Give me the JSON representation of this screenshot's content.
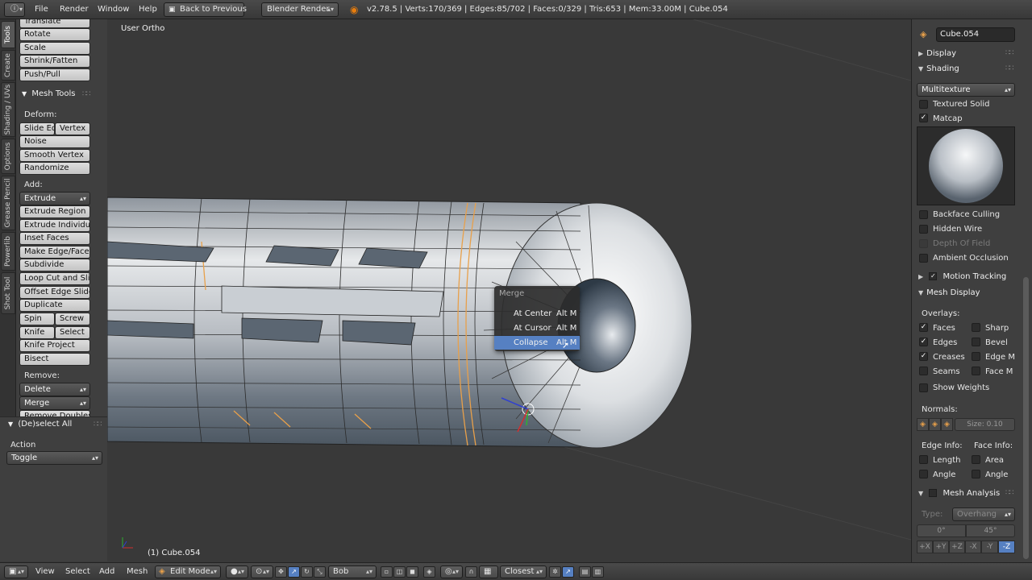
{
  "top_header": {
    "menus": [
      "File",
      "Render",
      "Window",
      "Help"
    ],
    "back_button": "Back to Previous",
    "render_engine": "Blender Render",
    "stats": "v2.78.5 | Verts:170/369 | Edges:85/702 | Faces:0/329 | Tris:653 | Mem:33.00M | Cube.054"
  },
  "left_tabs": [
    "Tools",
    "Create",
    "Shading / UVs",
    "Options",
    "Grease Pencil",
    "Powerlib",
    "Shot Tool"
  ],
  "tool_shelf": {
    "transform_buttons": [
      "Translate",
      "Rotate",
      "Scale",
      "Shrink/Fatten",
      "Push/Pull"
    ],
    "mesh_tools_title": "Mesh Tools",
    "deform_label": "Deform:",
    "slide_edge": "Slide Ed",
    "vertex": "Vertex",
    "noise": "Noise",
    "smooth_vertex": "Smooth Vertex",
    "randomize": "Randomize",
    "add_label": "Add:",
    "extrude": "Extrude",
    "add_buttons": [
      "Extrude Region",
      "Extrude Individual",
      "Inset Faces",
      "Make Edge/Face",
      "Subdivide",
      "Loop Cut and Slide",
      "Offset Edge Slide",
      "Duplicate"
    ],
    "spin": "Spin",
    "screw": "Screw",
    "knife": "Knife",
    "select": "Select",
    "knife_project": "Knife Project",
    "bisect": "Bisect",
    "remove_label": "Remove:",
    "delete": "Delete",
    "merge": "Merge",
    "remove_doubles": "Remove Doubles"
  },
  "operator_panel": {
    "title": "(De)select All",
    "action_label": "Action",
    "action_value": "Toggle"
  },
  "viewport": {
    "view_label": "User Ortho",
    "object_label": "(1) Cube.054"
  },
  "merge_menu": {
    "title": "Merge",
    "items": [
      {
        "label": "At Center",
        "shortcut": "Alt M"
      },
      {
        "label": "At Cursor",
        "shortcut": "Alt M"
      },
      {
        "label": "Collapse",
        "shortcut": "Alt M"
      }
    ]
  },
  "properties": {
    "object_name": "Cube.054",
    "display_title": "Display",
    "shading_title": "Shading",
    "shading_mode": "Multitexture",
    "textured_solid": "Textured Solid",
    "matcap": "Matcap",
    "backface_culling": "Backface Culling",
    "hidden_wire": "Hidden Wire",
    "depth_of_field": "Depth Of Field",
    "ambient_occlusion": "Ambient Occlusion",
    "motion_tracking": "Motion Tracking",
    "mesh_display_title": "Mesh Display",
    "overlays_label": "Overlays:",
    "overlay_left": [
      {
        "label": "Faces",
        "checked": "✓"
      },
      {
        "label": "Edges",
        "checked": "✓"
      },
      {
        "label": "Creases",
        "checked": "✓"
      },
      {
        "label": "Seams",
        "checked": ""
      }
    ],
    "overlay_right": [
      {
        "label": "Sharp",
        "checked": ""
      },
      {
        "label": "Bevel",
        "checked": ""
      },
      {
        "label": "Edge M",
        "checked": ""
      },
      {
        "label": "Face M",
        "checked": ""
      }
    ],
    "show_weights": "Show Weights",
    "normals_label": "Normals:",
    "normals_size": "Size: 0.10",
    "edge_info_label": "Edge Info:",
    "face_info_label": "Face Info:",
    "edge_length": "Length",
    "edge_angle": "Angle",
    "face_area": "Area",
    "face_angle": "Angle",
    "mesh_analysis_title": "Mesh Analysis",
    "type_label": "Type:",
    "type_value": "Overhang",
    "range_min": "0°",
    "range_max": "45°",
    "axis_buttons": [
      "+X",
      "+Y",
      "+Z",
      "-X",
      "-Y",
      "-Z"
    ]
  },
  "bottom_header": {
    "view": "View",
    "select": "Select",
    "add": "Add",
    "mesh": "Mesh",
    "mode": "Edit Mode",
    "pivot_label": "Bob",
    "snap_target": "Closest"
  },
  "colors": {
    "selection_accent": "#5680c2",
    "edge_highlight": "#e8a04a"
  }
}
